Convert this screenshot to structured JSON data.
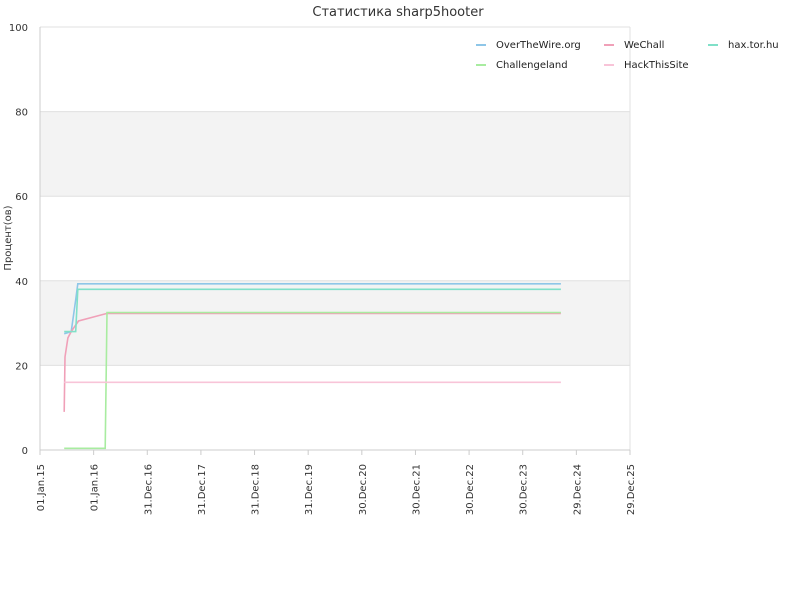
{
  "chart_data": {
    "type": "line",
    "title": "Статистика sharp5hooter",
    "xlabel": "",
    "ylabel": "Процент(ов)",
    "x_ticks": [
      "01.Jan.15",
      "01.Jan.16",
      "31.Dec.16",
      "31.Dec.17",
      "31.Dec.18",
      "31.Dec.19",
      "30.Dec.20",
      "30.Dec.21",
      "30.Dec.22",
      "30.Dec.23",
      "29.Dec.24",
      "29.Dec.25"
    ],
    "y_ticks": [
      0,
      20,
      40,
      60,
      80,
      100
    ],
    "xlim": [
      "2015-01-01",
      "2025-12-29"
    ],
    "ylim": [
      0,
      100
    ],
    "grid": true,
    "background_bands": "alternating grey between 20-40 and 60-80",
    "legend_position": "top-right",
    "series": [
      {
        "name": "OverTheWire.org",
        "color": "#8ec6e8",
        "x": [
          "2015-06-15",
          "2015-08-01",
          "2015-09-01",
          "2015-09-15",
          "2024-09-15"
        ],
        "y": [
          27.5,
          28.0,
          35.5,
          39.3,
          39.3
        ]
      },
      {
        "name": "WeChall",
        "color": "#f0a0b8",
        "x": [
          "2015-06-15",
          "2015-06-20",
          "2015-07-10",
          "2015-08-01",
          "2015-09-20",
          "2016-04-01",
          "2024-09-15"
        ],
        "y": [
          9.0,
          22.0,
          26.5,
          28.0,
          30.5,
          32.3,
          32.3
        ]
      },
      {
        "name": "hax.tor.hu",
        "color": "#80e0c8",
        "x": [
          "2015-06-15",
          "2015-09-01",
          "2015-09-15",
          "2024-09-15"
        ],
        "y": [
          28.0,
          28.0,
          38.0,
          38.0
        ]
      },
      {
        "name": "Challengeland",
        "color": "#a8eca0",
        "x": [
          "2015-06-15",
          "2016-03-20",
          "2016-04-01",
          "2024-09-15"
        ],
        "y": [
          0.4,
          0.4,
          32.5,
          32.5
        ]
      },
      {
        "name": "HackThisSite",
        "color": "#f8c4d8",
        "x": [
          "2015-06-15",
          "2024-09-15"
        ],
        "y": [
          16.0,
          16.0
        ]
      }
    ]
  }
}
